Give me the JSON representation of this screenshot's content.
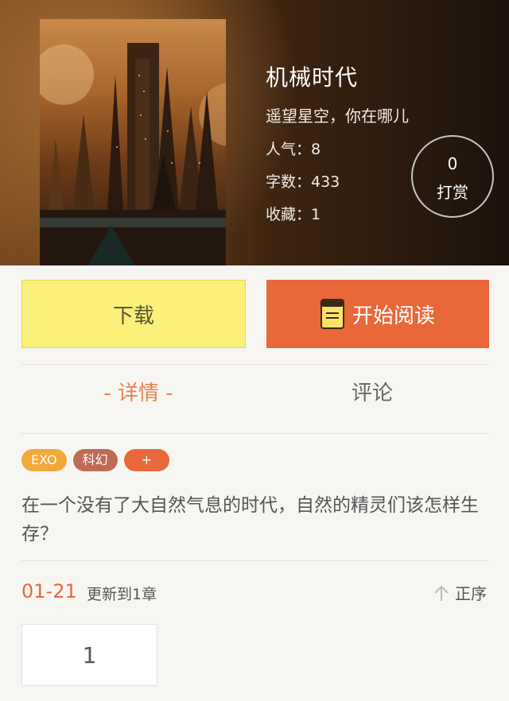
{
  "book": {
    "title": "机械时代",
    "author": "遥望星空，你在哪儿",
    "popularity": "人气：8",
    "word_count": "字数：433",
    "favorites": "收藏：1"
  },
  "tip": {
    "count": "0",
    "label": "打赏"
  },
  "actions": {
    "download_label": "下载",
    "read_label": "开始阅读"
  },
  "tabs": [
    {
      "label": "- 详情 -"
    },
    {
      "label": "评论"
    }
  ],
  "tags": [
    "EXO",
    "科幻",
    "+"
  ],
  "summary": "在一个没有了大自然气息的时代，自然的精灵们该怎样生存？",
  "update": {
    "date": "01-21",
    "text": "更新到1章",
    "sort_label": "正序"
  },
  "chapters": [
    "1"
  ],
  "colors": {
    "accent": "#e8683a",
    "download_bg": "#fbf07a"
  }
}
